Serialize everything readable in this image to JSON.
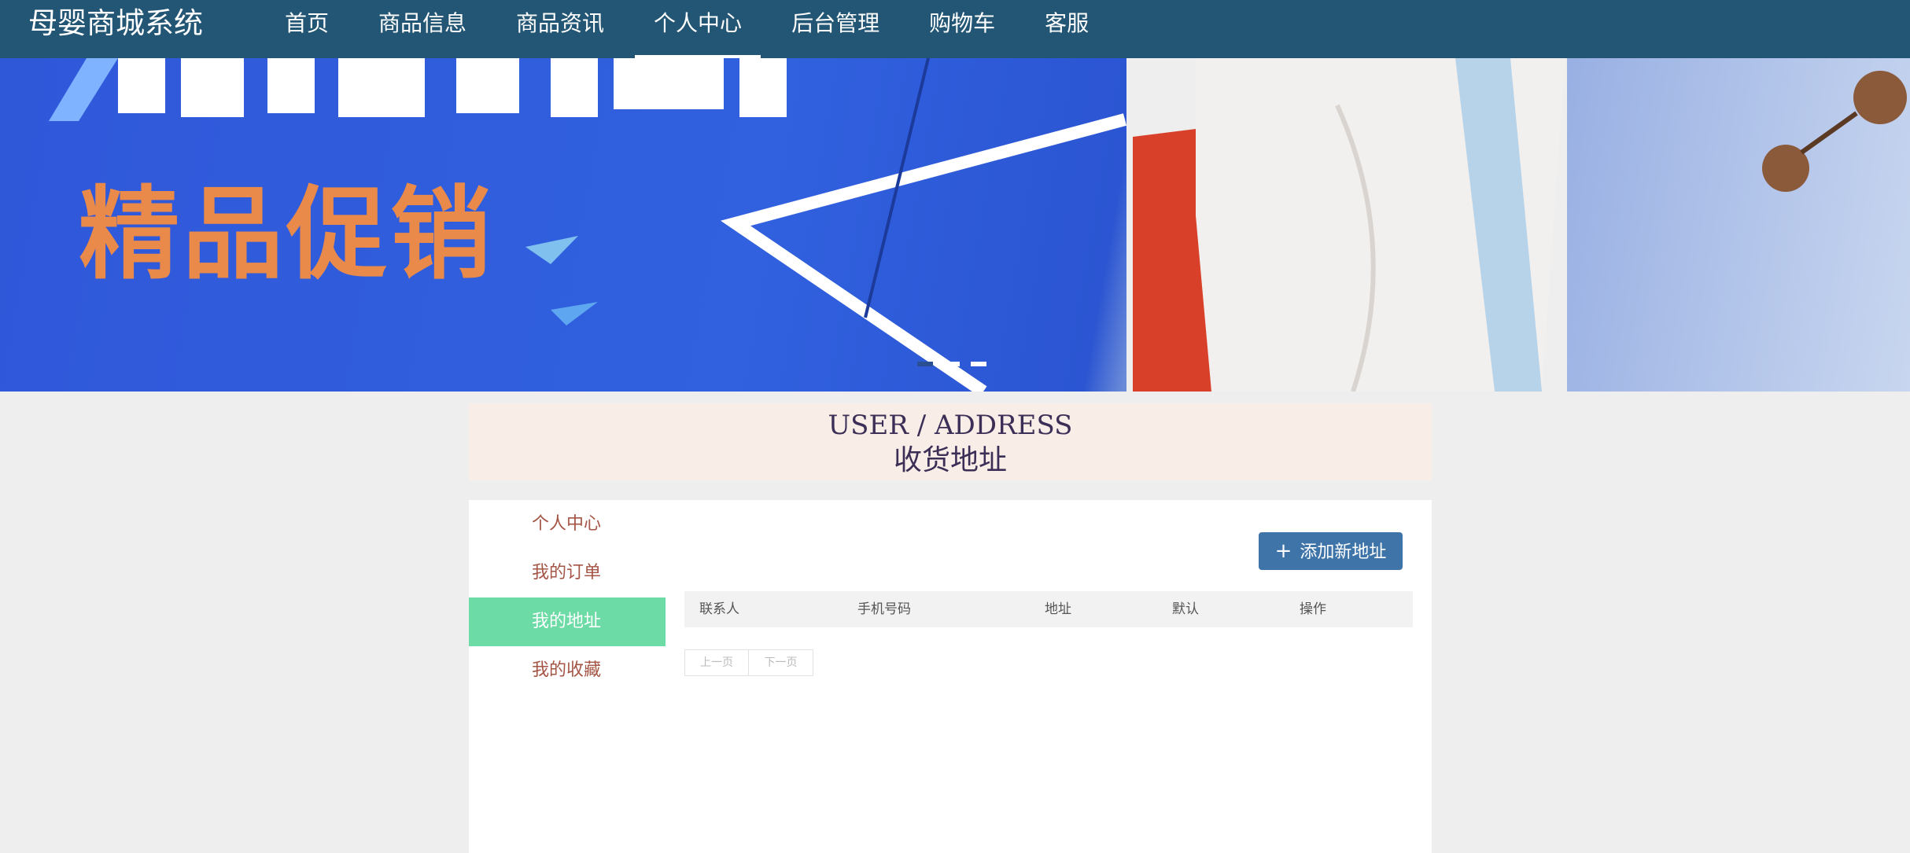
{
  "header": {
    "brand": "母婴商城系统",
    "nav": [
      "首页",
      "商品信息",
      "商品资讯",
      "个人中心",
      "后台管理",
      "购物车",
      "客服"
    ],
    "active_nav": "个人中心"
  },
  "banner": {
    "promo_text": "精品促销",
    "indicator": {
      "count": 3,
      "active_index": 0
    }
  },
  "page_header": {
    "title_en": "USER / ADDRESS",
    "title_cn": "收货地址"
  },
  "sidebar": {
    "items": [
      {
        "label": "个人中心"
      },
      {
        "label": "我的订单"
      },
      {
        "label": "我的地址"
      },
      {
        "label": "我的收藏"
      }
    ],
    "active_item": "我的地址"
  },
  "toolbar": {
    "add_button_icon": "plus-icon",
    "add_button_label": "添加新地址"
  },
  "table": {
    "columns": [
      "联系人",
      "手机号码",
      "地址",
      "默认",
      "操作"
    ],
    "rows": []
  },
  "pagination": {
    "prev": "上一页",
    "next": "下一页"
  },
  "colors": {
    "topbar": "#235674",
    "active_sidebar": "#6cdba6",
    "primary_button": "#3e74a8",
    "sidebar_text": "#a45545"
  }
}
